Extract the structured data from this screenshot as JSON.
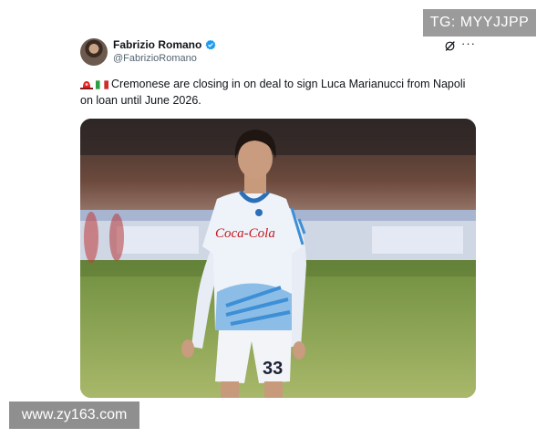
{
  "watermarks": {
    "top_right": "TG: MYYJJPP",
    "bottom_left": "www.zy163.com"
  },
  "tweet": {
    "author_name": "Fabrizio Romano",
    "author_handle": "@FabrizioRomano",
    "verified": true,
    "text": "Cremonese are closing in on deal to sign Luca Marianucci from Napoli on loan until June 2026.",
    "emoji_prefix": [
      "siren-icon",
      "italy-flag-icon"
    ],
    "actions": {
      "grok": "grok-icon",
      "more": "···"
    }
  },
  "photo": {
    "shirt_sponsor": "Coca-Cola",
    "shirt_number": "33",
    "colors": {
      "shirt": "#eaf0f7",
      "stripes": "#3d8fd6",
      "pitch": "#7f9a4a"
    }
  }
}
